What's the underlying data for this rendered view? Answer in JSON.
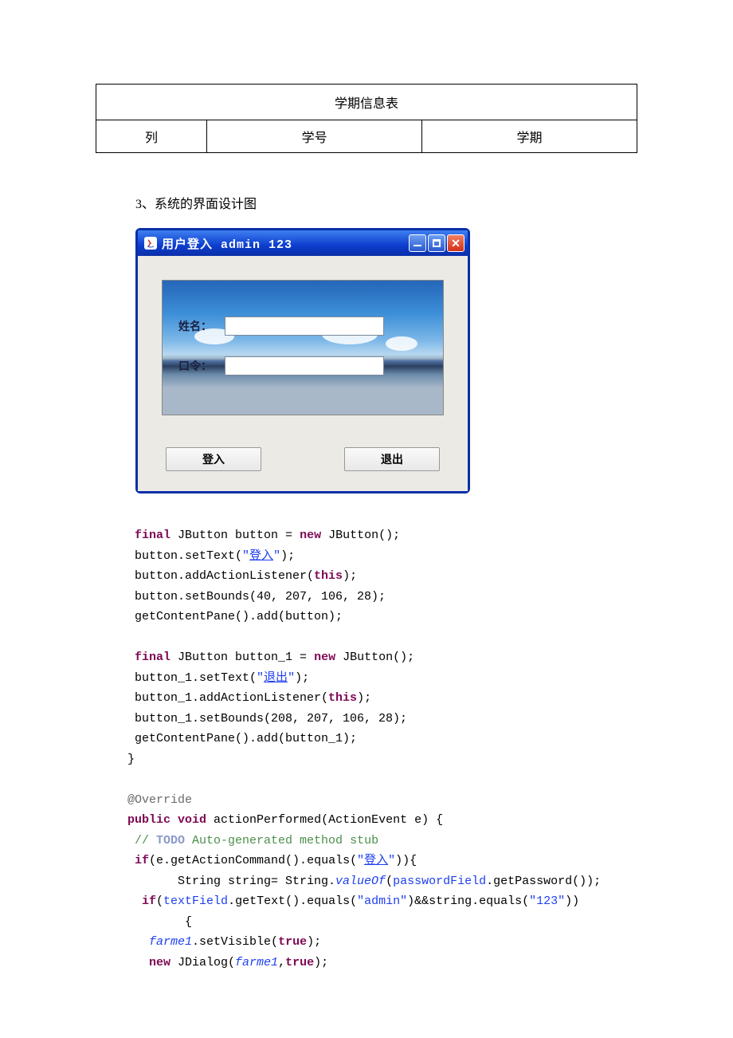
{
  "table": {
    "title": "学期信息表",
    "cols": [
      "列",
      "学号",
      "学期"
    ]
  },
  "section_heading": "3、系统的界面设计图",
  "window": {
    "title": "用户登入 admin 123",
    "name_label": "姓名：",
    "password_label": "口令：",
    "login_button": "登入",
    "exit_button": "退出"
  },
  "code": {
    "l1a": "final",
    "l1b": " JButton button = ",
    "l1c": "new",
    "l1d": " JButton();",
    "l2a": " button.setText(",
    "l2b": "\"",
    "l2c": "登入",
    "l2d": "\"",
    "l2e": ");",
    "l3a": " button.addActionListener(",
    "l3b": "this",
    "l3c": ");",
    "l4": " button.setBounds(40, 207, 106, 28);",
    "l5": " getContentPane().add(button);",
    "l6a": "final",
    "l6b": " JButton button_1 = ",
    "l6c": "new",
    "l6d": " JButton();",
    "l7a": " button_1.setText(",
    "l7b": "\"",
    "l7c": "退出",
    "l7d": "\"",
    "l7e": ");",
    "l8a": " button_1.addActionListener(",
    "l8b": "this",
    "l8c": ");",
    "l9": " button_1.setBounds(208, 207, 106, 28);",
    "l10": " getContentPane().add(button_1);",
    "l11": "}",
    "l12": "@Override",
    "l13a": "public",
    "l13b": "void",
    "l13c": " actionPerformed(ActionEvent e) {",
    "l14a": " // ",
    "l14b": "TODO",
    "l14c": " Auto-generated method stub",
    "l15a": "if",
    "l15b": "(e.getActionCommand().equals(",
    "l15c": "\"",
    "l15d": "登入",
    "l15e": "\"",
    "l15f": ")){",
    "l16a": "       String string= String.",
    "l16b": "valueOf",
    "l16c": "(",
    "l16d": "passwordField",
    "l16e": ".getPassword());",
    "l17a": "if",
    "l17b": "(",
    "l17c": "textField",
    "l17d": ".getText().equals(",
    "l17e": "\"admin\"",
    "l17f": ")&&string.equals(",
    "l17g": "\"123\"",
    "l17h": "))",
    "l18": "        {",
    "l19a": "farme1",
    "l19b": ".setVisible(",
    "l19c": "true",
    "l19d": ");",
    "l20a": "new",
    "l20b": " JDialog(",
    "l20c": "farme1",
    "l20d": ",",
    "l20e": "true",
    "l20f": ");"
  }
}
